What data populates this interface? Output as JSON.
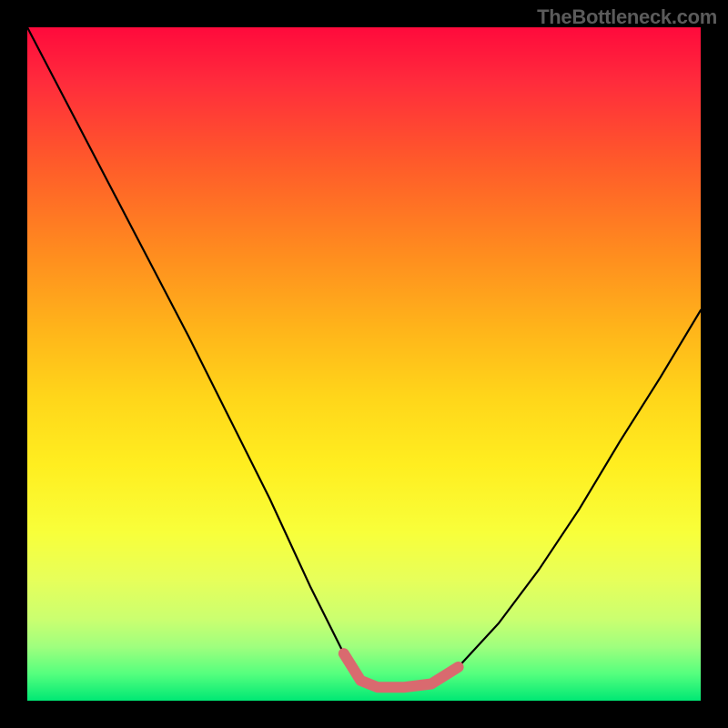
{
  "watermark": "TheBottleneck.com",
  "chart_data": {
    "type": "line",
    "title": "",
    "xlabel": "",
    "ylabel": "",
    "xlim": [
      0,
      1
    ],
    "ylim": [
      0,
      1
    ],
    "series": [
      {
        "name": "bottleneck-curve",
        "x": [
          0.0,
          0.06,
          0.12,
          0.18,
          0.24,
          0.3,
          0.36,
          0.42,
          0.47,
          0.495,
          0.52,
          0.56,
          0.6,
          0.64,
          0.7,
          0.76,
          0.82,
          0.88,
          0.94,
          1.0
        ],
        "y": [
          1.0,
          0.885,
          0.77,
          0.655,
          0.54,
          0.42,
          0.3,
          0.17,
          0.07,
          0.03,
          0.02,
          0.02,
          0.025,
          0.05,
          0.115,
          0.195,
          0.285,
          0.385,
          0.48,
          0.58
        ]
      },
      {
        "name": "trough-highlight",
        "x": [
          0.47,
          0.495,
          0.52,
          0.56,
          0.6,
          0.64
        ],
        "y": [
          0.07,
          0.03,
          0.02,
          0.02,
          0.025,
          0.05
        ]
      }
    ],
    "background_gradient": {
      "top": "#ff0a3c",
      "mid": "#ffee20",
      "bottom": "#00e874"
    }
  }
}
